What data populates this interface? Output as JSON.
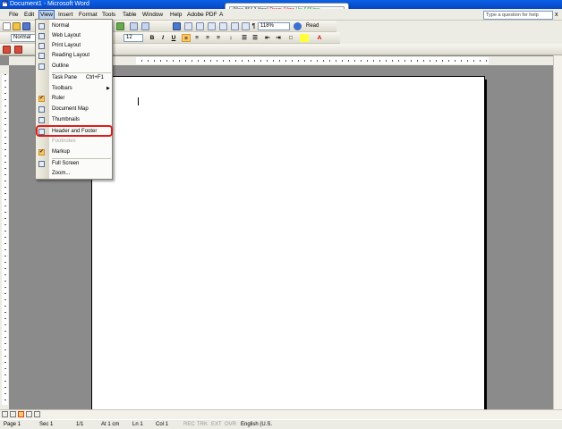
{
  "window": {
    "title": "Document1 - Microsoft Word"
  },
  "net_monitor": {
    "max": "(Max: 864.3 kbps)",
    "down": "Down: 0 bps",
    "up": "Up: 648 bps"
  },
  "menubar": {
    "items": [
      "File",
      "Edit",
      "View",
      "Insert",
      "Format",
      "Tools",
      "Table",
      "Window",
      "Help",
      "Adobe PDF",
      "A"
    ],
    "help_placeholder": "Type a question for help",
    "close": "x"
  },
  "toolbar": {
    "style": "Normal",
    "font_size": "12",
    "zoom": "118%",
    "read_label": "Read"
  },
  "view_menu": {
    "items": [
      {
        "label": "Normal",
        "shortcut": "",
        "icon": "normal-view-icon"
      },
      {
        "label": "Web Layout",
        "shortcut": "",
        "icon": "web-layout-icon"
      },
      {
        "label": "Print Layout",
        "shortcut": "",
        "icon": "print-layout-icon"
      },
      {
        "label": "Reading Layout",
        "shortcut": "",
        "icon": "reading-layout-icon"
      },
      {
        "label": "Outline",
        "shortcut": "",
        "icon": "outline-view-icon"
      },
      {
        "label": "Task Pane",
        "shortcut": "Ctrl+F1",
        "icon": ""
      },
      {
        "label": "Toolbars",
        "shortcut": "",
        "icon": "",
        "submenu": true
      },
      {
        "label": "Ruler",
        "shortcut": "",
        "icon": "check-icon",
        "checked": true
      },
      {
        "label": "Document Map",
        "shortcut": "",
        "icon": "document-map-icon"
      },
      {
        "label": "Thumbnails",
        "shortcut": "",
        "icon": "thumbnails-icon"
      },
      {
        "label": "Header and Footer",
        "shortcut": "",
        "icon": "header-footer-icon",
        "highlighted": true
      },
      {
        "label": "Footnotes",
        "shortcut": "",
        "icon": "",
        "disabled": true
      },
      {
        "label": "Markup",
        "shortcut": "",
        "icon": "markup-icon"
      },
      {
        "label": "Full Screen",
        "shortcut": "",
        "icon": "full-screen-icon"
      },
      {
        "label": "Zoom...",
        "shortcut": "",
        "icon": ""
      }
    ]
  },
  "statusbar": {
    "page": "Page 1",
    "sec": "Sec 1",
    "pages": "1/1",
    "at": "At 1 cm",
    "ln": "Ln 1",
    "col": "Col 1",
    "rec": "REC",
    "trk": "TRK",
    "ext": "EXT",
    "ovr": "OVR",
    "language": "English (U.S."
  },
  "colors": {
    "title_bar": "#0846c2",
    "highlight_ring": "#e01b1b"
  }
}
